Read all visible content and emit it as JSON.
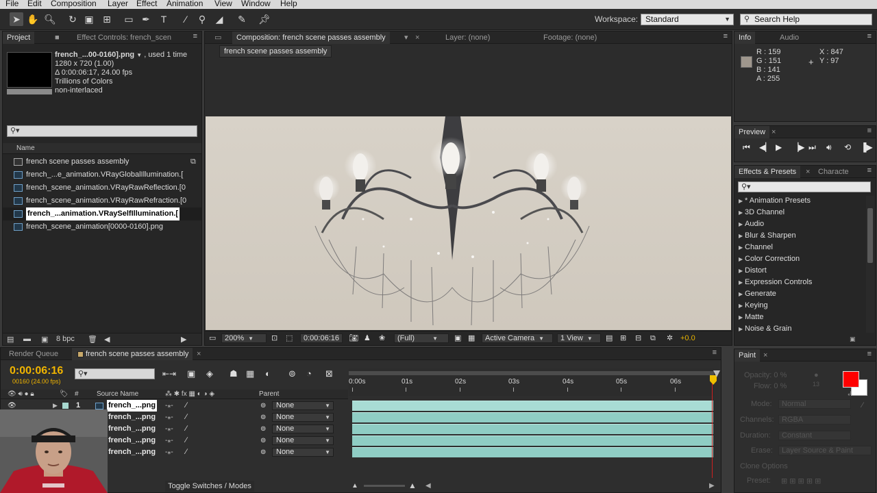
{
  "menu": [
    "File",
    "Edit",
    "Composition",
    "Layer",
    "Effect",
    "Animation",
    "View",
    "Window",
    "Help"
  ],
  "toolbar": {
    "workspace_label": "Workspace:",
    "workspace_value": "Standard",
    "search_help": "Search Help"
  },
  "project_panel": {
    "tab_project": "Project",
    "tab_effect_controls": "Effect Controls: french_scen",
    "selected_name": "french_...00-0160].png",
    "used": ", used 1 time",
    "dimensions": "1280 x 720 (1.00)",
    "duration": "Δ 0:00:06:17, 24.00 fps",
    "colors": "Trillions of Colors",
    "interlace": "non-interlaced",
    "search_placeholder": "",
    "column_name": "Name",
    "items": [
      {
        "label": "french scene passes assembly",
        "type": "comp"
      },
      {
        "label": "french_...e_animation.VRayGlobalIllumination.[",
        "type": "footage"
      },
      {
        "label": "french_scene_animation.VRayRawReflection.[0",
        "type": "footage"
      },
      {
        "label": "french_scene_animation.VRayRawRefraction.[0",
        "type": "footage"
      },
      {
        "label": "french_...animation.VRaySelfIllumination.[",
        "type": "footage",
        "selected": true
      },
      {
        "label": "french_scene_animation[0000-0160].png",
        "type": "footage"
      }
    ],
    "bpc": "8 bpc"
  },
  "comp_panel": {
    "tab_comp": "Composition: french scene passes assembly",
    "tab_layer": "Layer: (none)",
    "tab_footage": "Footage: (none)",
    "comp_name_pill": "french scene passes assembly",
    "zoom": "200%",
    "timecode": "0:00:06:16",
    "resolution": "(Full)",
    "camera": "Active Camera",
    "view": "1 View",
    "exposure": "+0.0"
  },
  "info_panel": {
    "tab_info": "Info",
    "tab_audio": "Audio",
    "r": "R : 159",
    "g": "G : 151",
    "b": "B : 141",
    "a": "A : 255",
    "x": "X : 847",
    "y": "Y : 97",
    "swatch_color": "#9f978d"
  },
  "preview_panel": {
    "tab": "Preview"
  },
  "effects_panel": {
    "tab_effects": "Effects & Presets",
    "tab_character": "Characte",
    "search_placeholder": "",
    "categories": [
      "* Animation Presets",
      "3D Channel",
      "Audio",
      "Blur & Sharpen",
      "Channel",
      "Color Correction",
      "Distort",
      "Expression Controls",
      "Generate",
      "Keying",
      "Matte",
      "Noise & Grain"
    ]
  },
  "timeline": {
    "tab_render_queue": "Render Queue",
    "tab_comp": "french scene passes assembly",
    "current_time": "0:00:06:16",
    "fps_info": "00160 (24.00 fps)",
    "col_source_name": "Source Name",
    "col_num": "#",
    "col_parent": "Parent",
    "ruler": [
      "0:00s",
      "01s",
      "02s",
      "03s",
      "04s",
      "05s",
      "06s"
    ],
    "layers": [
      {
        "num": "1",
        "name": "french_...png",
        "parent": "None",
        "selected": true
      },
      {
        "num": "",
        "name": "french_...png",
        "parent": "None"
      },
      {
        "num": "",
        "name": "french_...png",
        "parent": "None"
      },
      {
        "num": "",
        "name": "french_...png",
        "parent": "None"
      },
      {
        "num": "",
        "name": "french_...png",
        "parent": "None"
      }
    ],
    "toggle_label": "Toggle Switches / Modes",
    "bar_color": "#8fcdc4",
    "cti_color": "#f0c000"
  },
  "paint_panel": {
    "tab": "Paint",
    "opacity": "Opacity: 0 %",
    "flow": "Flow: 0 %",
    "mode_label": "Mode:",
    "mode_value": "Normal",
    "channels_label": "Channels:",
    "channels_value": "RGBA",
    "duration_label": "Duration:",
    "duration_value": "Constant",
    "erase_label": "Erase:",
    "erase_value": "Layer Source & Paint",
    "clone_options": "Clone Options",
    "preset_label": "Preset:",
    "brush_size": "13",
    "foreground_color": "#ff0000",
    "background_color": "#ffffff"
  }
}
